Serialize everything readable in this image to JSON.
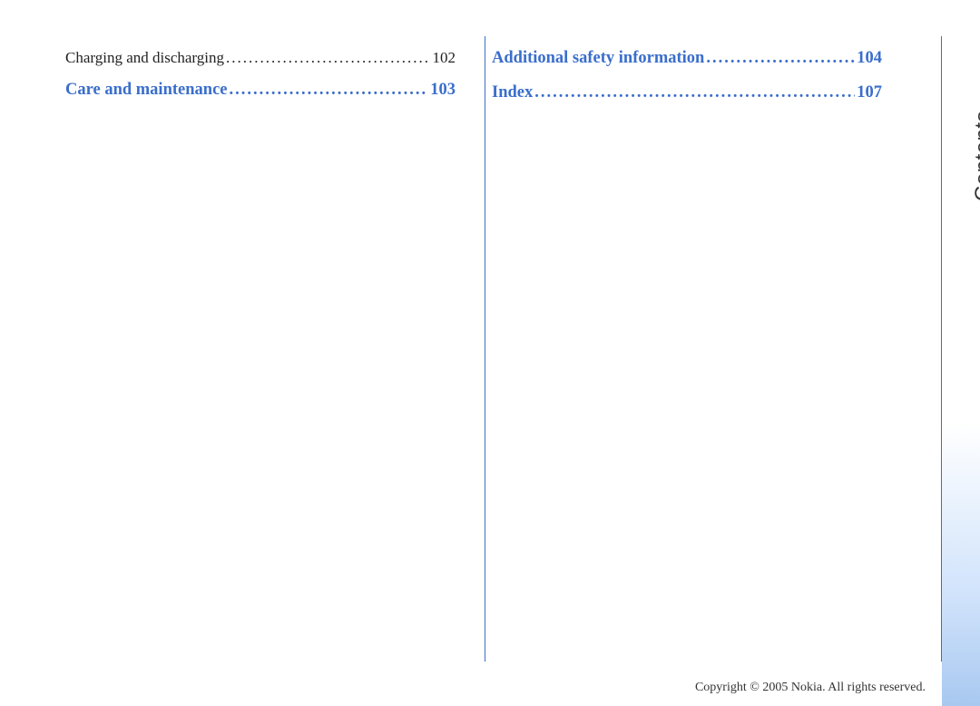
{
  "sideTab": {
    "label": "Contents"
  },
  "columns": {
    "left": [
      {
        "title": "Charging and discharging",
        "page": "102",
        "style": "body"
      },
      {
        "title": "Care and maintenance ",
        "page": "103",
        "style": "heading"
      }
    ],
    "right": [
      {
        "title": "Additional safety information",
        "page": "104",
        "style": "heading"
      },
      {
        "title": "Index ",
        "page": "107",
        "style": "heading"
      }
    ]
  },
  "footer": {
    "copyright": "Copyright © 2005 Nokia. All rights reserved."
  },
  "dots": "............................................................................................................"
}
